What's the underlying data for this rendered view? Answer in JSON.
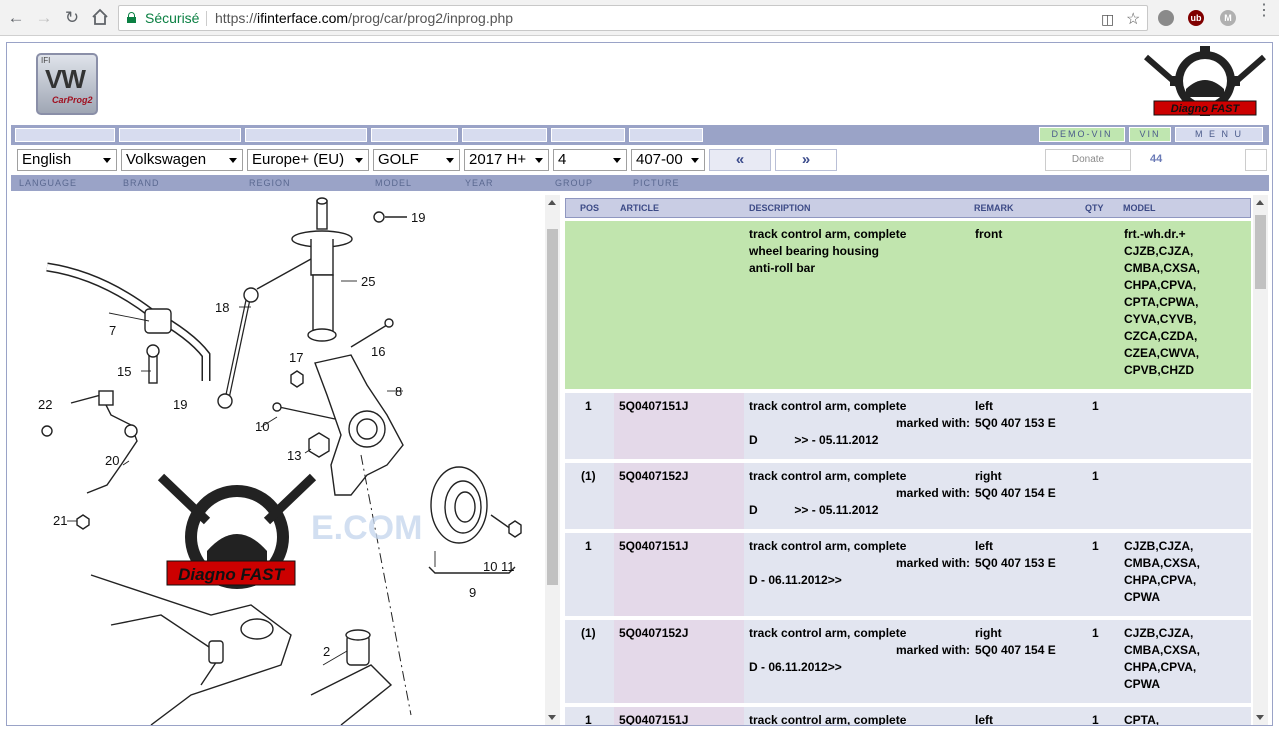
{
  "browser": {
    "secure_label": "Sécurisé",
    "url_prefix": "https://",
    "url_domain": "ifinterface.com",
    "url_path": "/prog/car/prog2/inprog.php"
  },
  "logo": {
    "ifi": "IFI",
    "vw": "VW",
    "carprog": "CarProg2"
  },
  "brand_watermark": "Diagno FAST",
  "top_buttons": {
    "demo_vin": "DEMO-VIN",
    "vin": "VIN",
    "menu": "M E N U"
  },
  "selectors": {
    "language": "English",
    "brand": "Volkswagen",
    "region": "Europe+ (EU)",
    "model": "GOLF",
    "year": "2017  H+",
    "group": "4",
    "picture": "407-00"
  },
  "nav": {
    "prev": "«",
    "next": "»"
  },
  "donate": "Donate",
  "count": "44",
  "labels": {
    "language": "LANGUAGE",
    "brand": "BRAND",
    "region": "REGION",
    "model": "MODEL",
    "year": "YEAR",
    "group": "GROUP",
    "picture": "PICTURE"
  },
  "diagram": {
    "callouts": [
      "19",
      "25",
      "18",
      "7",
      "16",
      "17",
      "8",
      "15",
      "19",
      "22",
      "10",
      "13",
      "20",
      "21",
      "9",
      "10",
      "11",
      "2"
    ],
    "watermark_text": "E.COM"
  },
  "table": {
    "headers": {
      "pos": "POS",
      "article": "ARTICLE",
      "description": "DESCRIPTION",
      "remark": "REMARK",
      "qty": "QTY",
      "model": "MODEL"
    },
    "group_row": {
      "description": [
        "track control arm, complete",
        "wheel bearing housing",
        "anti-roll bar"
      ],
      "remark": "front",
      "model": [
        "frt.-wh.dr.+",
        "CJZB,CJZA,",
        "CMBA,CXSA,",
        "CHPA,CPVA,",
        "CPTA,CPWA,",
        "CYVA,CYVB,",
        "CZCA,CZDA,",
        "CZEA,CWVA,",
        "CPVB,CHZD"
      ]
    },
    "rows": [
      {
        "pos": "1",
        "article": "5Q0407151J",
        "desc": "track control arm, complete",
        "marked": "marked with:",
        "remark1": "left",
        "remark2": "5Q0 407 153 E",
        "date": "D           >> - 05.11.2012",
        "qty": "1",
        "model": []
      },
      {
        "pos": "(1)",
        "article": "5Q0407152J",
        "desc": "track control arm, complete",
        "marked": "marked with:",
        "remark1": "right",
        "remark2": "5Q0 407 154 E",
        "date": "D           >> - 05.11.2012",
        "qty": "1",
        "model": []
      },
      {
        "pos": "1",
        "article": "5Q0407151J",
        "desc": "track control arm, complete",
        "marked": "marked with:",
        "remark1": "left",
        "remark2": "5Q0 407 153 E",
        "date": "D - 06.11.2012>>",
        "qty": "1",
        "model": [
          "CJZB,CJZA,",
          "CMBA,CXSA,",
          "CHPA,CPVA,",
          "CPWA"
        ]
      },
      {
        "pos": "(1)",
        "article": "5Q0407152J",
        "desc": "track control arm, complete",
        "marked": "marked with:",
        "remark1": "right",
        "remark2": "5Q0 407 154 E",
        "date": "D - 06.11.2012>>",
        "qty": "1",
        "model": [
          "CJZB,CJZA,",
          "CMBA,CXSA,",
          "CHPA,CPVA,",
          "CPWA"
        ]
      },
      {
        "pos": "1",
        "article": "5Q0407151J",
        "desc": "track control arm, complete",
        "marked": "",
        "remark1": "left",
        "remark2": "",
        "date": "",
        "qty": "1",
        "model": [
          "CPTA,"
        ]
      }
    ]
  }
}
